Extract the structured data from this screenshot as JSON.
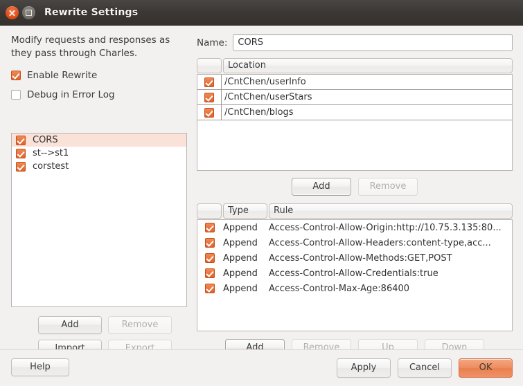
{
  "window": {
    "title": "Rewrite Settings",
    "controls": {
      "close": "close-icon",
      "maximize": "maximize-icon"
    }
  },
  "left": {
    "intro": "Modify requests and responses as they pass through Charles.",
    "checkboxes": [
      {
        "label": "Enable Rewrite",
        "checked": true
      },
      {
        "label": "Debug in Error Log",
        "checked": false
      }
    ],
    "sets": [
      {
        "label": "CORS",
        "checked": true,
        "selected": true
      },
      {
        "label": "st-->st1",
        "checked": true,
        "selected": false
      },
      {
        "label": "corstest",
        "checked": true,
        "selected": false
      }
    ],
    "buttons": [
      {
        "label": "Add",
        "enabled": true
      },
      {
        "label": "Remove",
        "enabled": false
      },
      {
        "label": "Import",
        "enabled": true
      },
      {
        "label": "Export",
        "enabled": false
      }
    ]
  },
  "right": {
    "name_label": "Name:",
    "name_value": "CORS",
    "location_table": {
      "headers": {
        "check": "",
        "location": "Location"
      },
      "rows": [
        {
          "checked": true,
          "location": "/CntChen/userInfo"
        },
        {
          "checked": true,
          "location": "/CntChen/userStars"
        },
        {
          "checked": true,
          "location": "/CntChen/blogs"
        }
      ]
    },
    "location_buttons": [
      {
        "label": "Add",
        "enabled": true
      },
      {
        "label": "Remove",
        "enabled": false
      }
    ],
    "rule_table": {
      "headers": {
        "check": "",
        "type": "Type",
        "rule": "Rule"
      },
      "rows": [
        {
          "checked": true,
          "type": "Append",
          "rule": "Access-Control-Allow-Origin:http://10.75.3.135:80..."
        },
        {
          "checked": true,
          "type": "Append",
          "rule": "Access-Control-Allow-Headers:content-type,acc..."
        },
        {
          "checked": true,
          "type": "Append",
          "rule": "Access-Control-Allow-Methods:GET,POST"
        },
        {
          "checked": true,
          "type": "Append",
          "rule": "Access-Control-Allow-Credentials:true"
        },
        {
          "checked": true,
          "type": "Append",
          "rule": "Access-Control-Max-Age:86400"
        }
      ]
    },
    "rule_buttons": [
      {
        "label": "Add",
        "enabled": true
      },
      {
        "label": "Remove",
        "enabled": false
      },
      {
        "label": "Up",
        "enabled": false
      },
      {
        "label": "Down",
        "enabled": false
      }
    ]
  },
  "footer": {
    "help": "Help",
    "apply": "Apply",
    "cancel": "Cancel",
    "ok": "OK"
  },
  "colors": {
    "accent": "#e2622a",
    "selection": "#fae2d9",
    "titlebar": "#3b3734",
    "window_bg": "#f2f1f0",
    "primary_button": "#ef8e60"
  }
}
